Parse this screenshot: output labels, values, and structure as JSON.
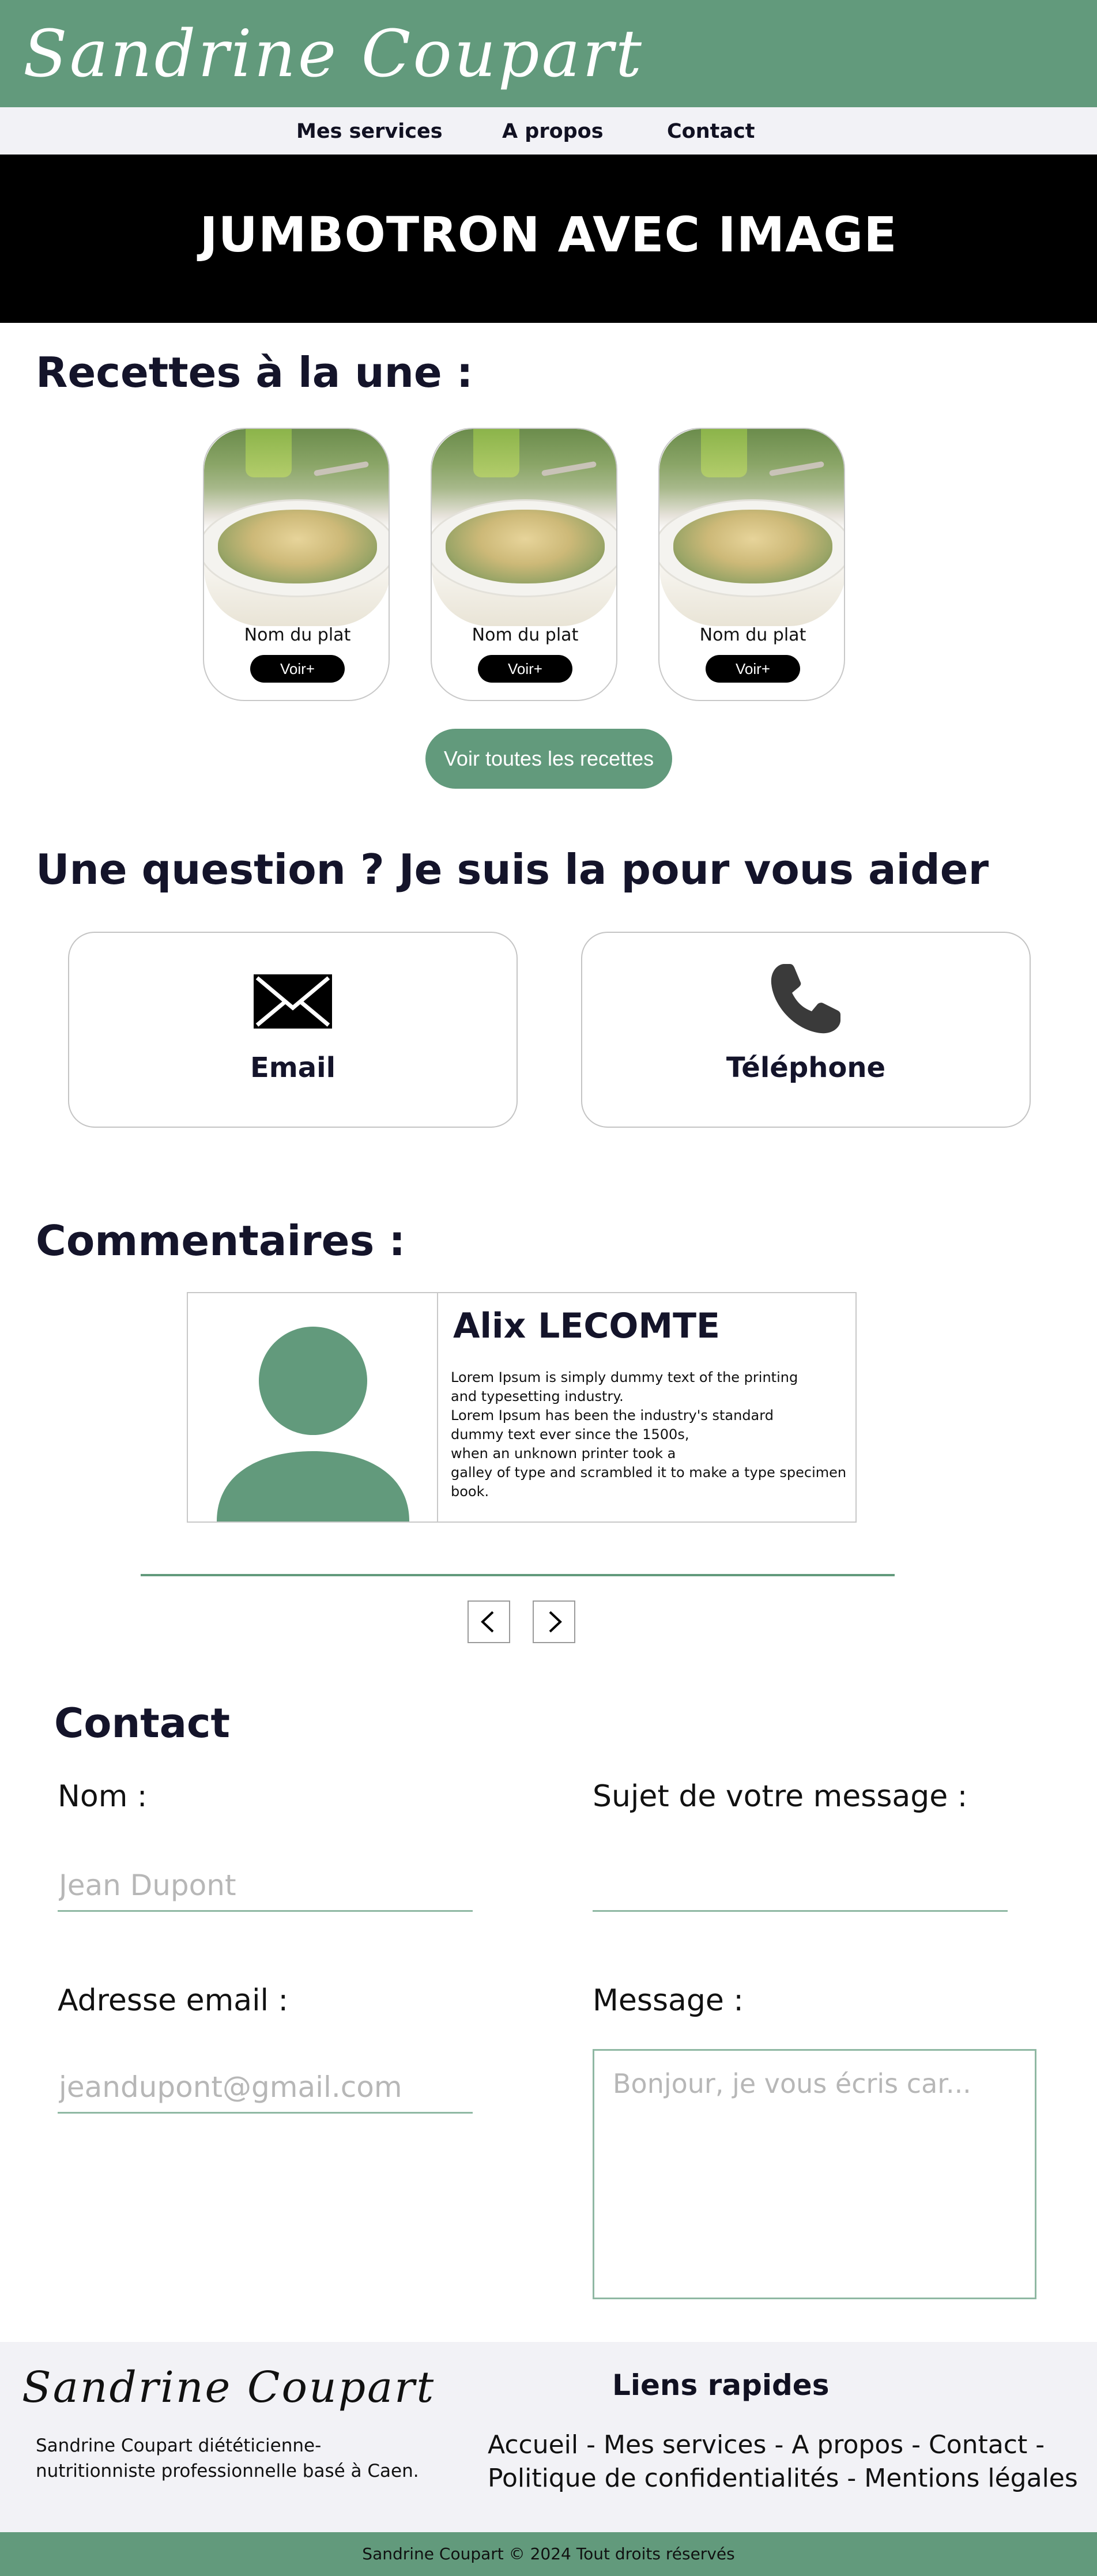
{
  "header": {
    "logo": "Sandrine Coupart",
    "brand_color": "#629a7c"
  },
  "nav": {
    "items": [
      {
        "label": "Mes services"
      },
      {
        "label": "A propos"
      },
      {
        "label": "Contact"
      }
    ]
  },
  "jumbotron": {
    "title": "JUMBOTRON AVEC IMAGE"
  },
  "recipes": {
    "title": "Recettes à la une :",
    "cards": [
      {
        "name": "Nom du plat",
        "button": "Voir+"
      },
      {
        "name": "Nom du plat",
        "button": "Voir+"
      },
      {
        "name": "Nom du plat",
        "button": "Voir+"
      }
    ],
    "all_button": "Voir toutes les recettes"
  },
  "help": {
    "title": "Une question ? Je suis la pour vous aider",
    "email_label": "Email",
    "email_icon": "envelope-icon",
    "phone_label": "Téléphone",
    "phone_icon": "phone-icon"
  },
  "comments": {
    "title": "Commentaires :",
    "author": "Alix LECOMTE",
    "text": "Lorem Ipsum is simply dummy text of the printing\nand typesetting industry.\nLorem Ipsum has been the industry's standard\n dummy text ever since the 1500s,\nwhen an unknown printer took a\ngalley of type and scrambled it to make a type specimen book.",
    "prev_icon": "chevron-left-icon",
    "next_icon": "chevron-right-icon"
  },
  "contact_form": {
    "title": "Contact",
    "name_label": "Nom :",
    "name_placeholder": "Jean Dupont",
    "subject_label": "Sujet de votre message :",
    "subject_placeholder": "",
    "email_label": "Adresse email :",
    "email_placeholder": "jeandupont@gmail.com",
    "message_label": "Message :",
    "message_placeholder": "Bonjour, je vous écris car..."
  },
  "footer": {
    "logo": "Sandrine Coupart",
    "description": "Sandrine Coupart diététicienne-nutritionniste professionnelle basé à Caen.",
    "quick_links_title": "Liens rapides",
    "links": [
      "Accueil",
      "Mes services",
      "A propos",
      "Contact",
      "Politique de confidentialités",
      "Mentions légales"
    ],
    "separator": " - ",
    "copyright": "Sandrine Coupart © 2024 Tout droits réservés"
  }
}
